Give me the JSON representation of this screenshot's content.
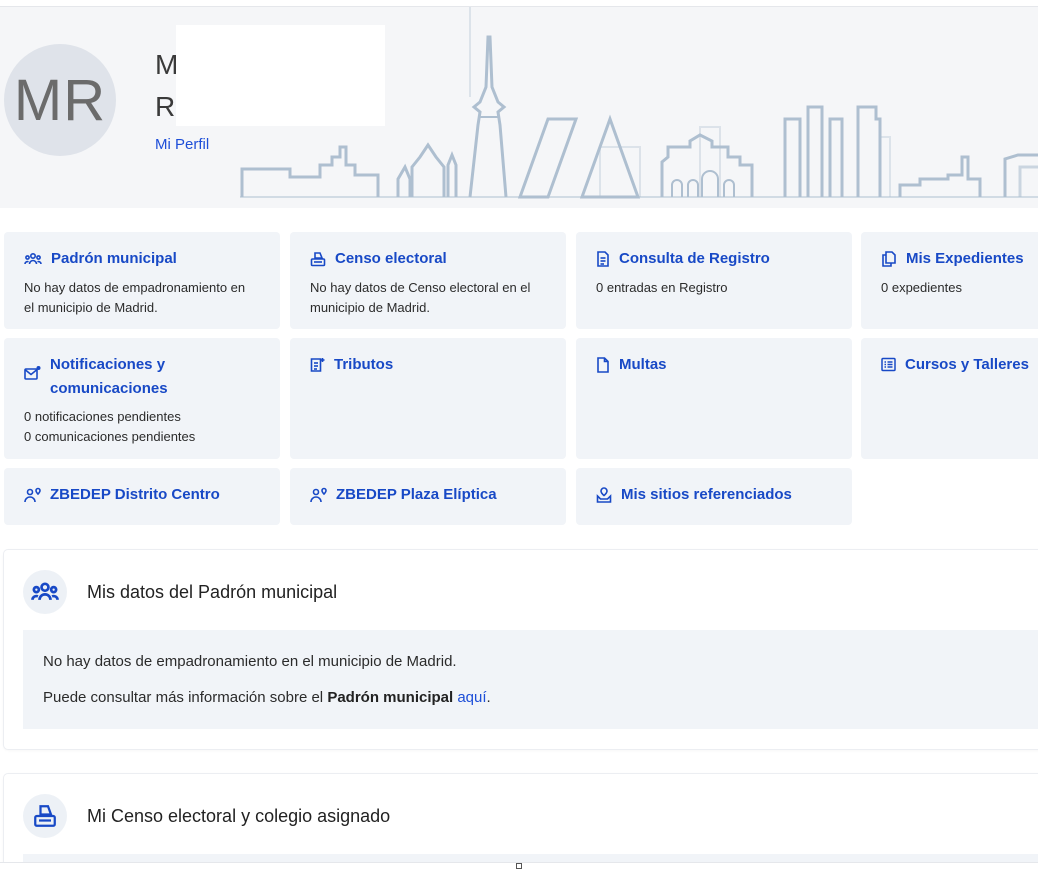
{
  "header": {
    "avatar_initials": "MR",
    "name_line_1": "M",
    "name_line_2": "R",
    "profile_link": "Mi Perfil"
  },
  "colors": {
    "accent": "#1849c6",
    "card_bg": "#f1f4f8",
    "header_bg": "#f5f6f8",
    "skyline": "#aebfd0"
  },
  "cards": [
    {
      "title": "Padrón municipal",
      "icon": "people-group-icon",
      "desc": [
        "No hay datos de empadronamiento en",
        "el municipio de Madrid."
      ]
    },
    {
      "title": "Censo electoral",
      "icon": "ballot-box-icon",
      "desc": [
        "No hay datos de Censo electoral en el",
        "municipio de Madrid."
      ]
    },
    {
      "title": "Consulta de Registro",
      "icon": "document-lines-icon",
      "desc": [
        "0 entradas en Registro"
      ]
    },
    {
      "title": "Mis Expedientes",
      "icon": "copy-documents-icon",
      "desc": [
        "0 expedientes"
      ]
    },
    {
      "title_lines": [
        "Notificaciones y",
        "comunicaciones"
      ],
      "icon": "mail-notification-icon",
      "desc": [
        "0 notificaciones pendientes",
        "0 comunicaciones pendientes"
      ]
    },
    {
      "title": "Tributos",
      "icon": "receipt-icon",
      "desc": []
    },
    {
      "title": "Multas",
      "icon": "document-icon",
      "desc": []
    },
    {
      "title": "Cursos y Talleres",
      "icon": "list-icon",
      "desc": []
    },
    {
      "title": "ZBEDEP Distrito Centro",
      "icon": "person-location-icon",
      "desc": []
    },
    {
      "title": "ZBEDEP Plaza Elíptica",
      "icon": "person-location-icon",
      "desc": []
    },
    {
      "title": "Mis sitios referenciados",
      "icon": "map-pin-hand-icon",
      "desc": []
    }
  ],
  "padron_section": {
    "title": "Mis datos del Padrón municipal",
    "line_1": "No hay datos de empadronamiento en el municipio de Madrid.",
    "line_2_prefix": "Puede consultar más información sobre el ",
    "line_2_bold": "Padrón municipal",
    "line_2_link": "aquí",
    "line_2_suffix": "."
  },
  "censo_section": {
    "title": "Mi Censo electoral y colegio asignado"
  }
}
